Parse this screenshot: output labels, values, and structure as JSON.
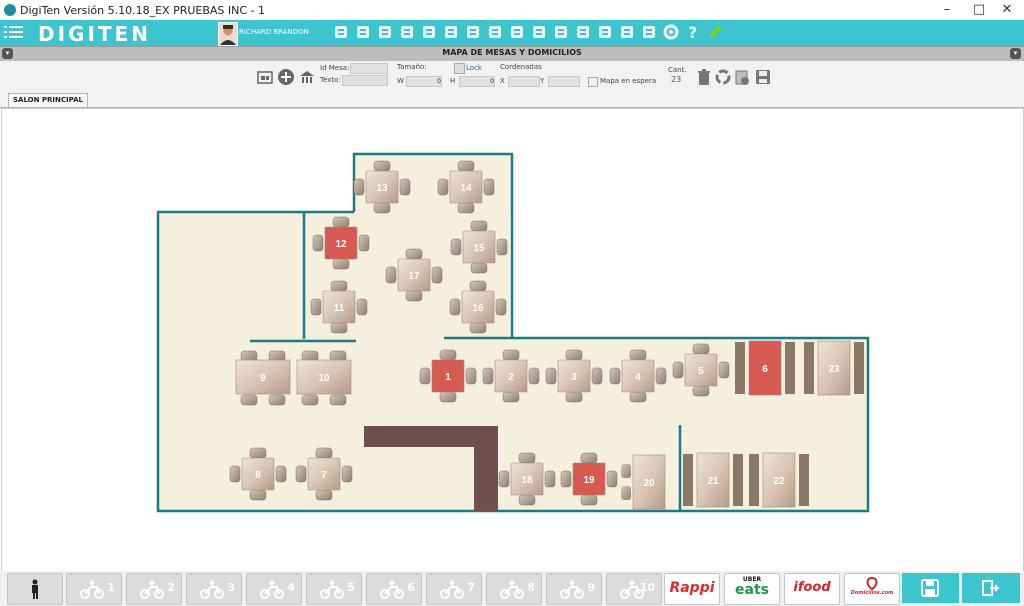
{
  "window": {
    "title": "DigiTen Versión 5.10.18_EX PRUEBAS INC - 1"
  },
  "header": {
    "logo": "DIGITEN",
    "user": "RICHARD BRANDON"
  },
  "section": {
    "title": "MAPA DE MESAS Y DOMICILIOS"
  },
  "toolbar": {
    "id_mesa_label": "Id Mesa:",
    "texto_label": "Texto:",
    "tamano_label": "Tamaño:",
    "lock_label": "Lock",
    "w_label": "W",
    "w_value": "0",
    "h_label": "H",
    "h_value": "0",
    "coords_label": "Cordenadas",
    "x_label": "X",
    "y_label": "Y",
    "waiting_map_label": "Mapa en espera",
    "cant_label": "Cant.",
    "cant_value": "23"
  },
  "tabs": [
    {
      "label": "SALON PRINCIPAL",
      "active": true
    }
  ],
  "colors": {
    "accent": "#3cc4cf",
    "wall": "#1a7c82",
    "floor": "#f5efdd",
    "occupied": "#d65a52",
    "bar": "#6e5050"
  },
  "tables": [
    {
      "n": "1",
      "status": "occupied"
    },
    {
      "n": "2",
      "status": "free"
    },
    {
      "n": "3",
      "status": "free"
    },
    {
      "n": "4",
      "status": "free"
    },
    {
      "n": "5",
      "status": "free"
    },
    {
      "n": "6",
      "status": "occupied"
    },
    {
      "n": "7",
      "status": "free"
    },
    {
      "n": "8",
      "status": "free"
    },
    {
      "n": "9",
      "status": "free"
    },
    {
      "n": "10",
      "status": "free"
    },
    {
      "n": "11",
      "status": "free"
    },
    {
      "n": "12",
      "status": "occupied"
    },
    {
      "n": "13",
      "status": "free"
    },
    {
      "n": "14",
      "status": "free"
    },
    {
      "n": "15",
      "status": "free"
    },
    {
      "n": "16",
      "status": "free"
    },
    {
      "n": "17",
      "status": "free"
    },
    {
      "n": "18",
      "status": "free"
    },
    {
      "n": "19",
      "status": "occupied"
    },
    {
      "n": "20",
      "status": "free"
    },
    {
      "n": "21",
      "status": "free"
    },
    {
      "n": "22",
      "status": "free"
    },
    {
      "n": "23",
      "status": "free"
    }
  ],
  "bottom": {
    "delivery": [
      "1",
      "2",
      "3",
      "4",
      "5",
      "6",
      "7",
      "8",
      "9",
      "10"
    ],
    "brands": {
      "rappi": "Rappi",
      "uber_top": "UBER",
      "uber_bottom": "eats",
      "ifood": "ifood",
      "domicilios": "Domicilios.com"
    }
  }
}
